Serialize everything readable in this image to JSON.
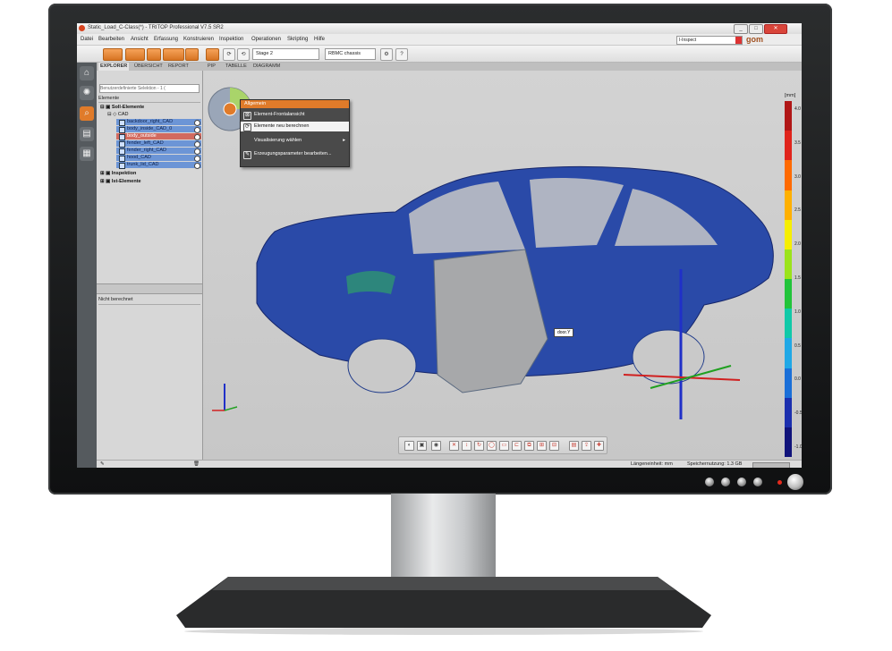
{
  "window": {
    "title": "Static_Load_C-Class(*) - TRITOP Professional V7.5 SR2",
    "controls": [
      "_",
      "□",
      "✕"
    ]
  },
  "menu": [
    "Datei",
    "Bearbeiten",
    "Ansicht",
    "Erfassung",
    "Konstruieren",
    "Inspektion",
    "Operationen",
    "Skripting",
    "Hilfe"
  ],
  "inspect_selector": "I-Inspect",
  "brand": "gom",
  "toolbar": {
    "stage": "Stage 2",
    "alignment": "RBMC chassis",
    "help": "?"
  },
  "tabs": [
    "EXPLORER",
    "ÜBERSICHT",
    "REPORT",
    "PIP",
    "TABELLE",
    "DIAGRAMM"
  ],
  "explorer": {
    "search_placeholder": "Benutzerdefinierte Selektion - 1 (",
    "header": "Elemente",
    "root": "Soll-Elemente",
    "cad": "CAD",
    "cad_items": [
      "backdoor_right_CAD",
      "body_inside_CAD_0",
      "body_outside",
      "fender_left_CAD",
      "fender_right_CAD",
      "hood_CAD",
      "trunk_lid_CAD"
    ],
    "selected_index": 2,
    "others": [
      "Inspektion",
      "Ist-Elemente"
    ],
    "lower_status": "Nicht berechnet"
  },
  "context_menu": {
    "header": "Allgemein",
    "items": [
      {
        "label": "Element-Frontalansicht",
        "icon": "frontal-view-icon"
      },
      {
        "label": "Elemente neu berechnen",
        "icon": "recompute-icon"
      },
      {
        "label": "Visualisierung wählen",
        "icon": ""
      },
      {
        "label": "Erzeugungsparameter bearbeiten...",
        "icon": "edit-params-icon"
      }
    ],
    "highlight_index": 1,
    "submenu_arrow": "▸"
  },
  "viewport": {
    "element_label": "door.Y"
  },
  "color_scale": {
    "unit": "[mm]",
    "labels": [
      "4.0",
      "3.5",
      "3.0",
      "2.5",
      "2.0",
      "1.5",
      "1.0",
      "0.5",
      "0.0",
      "-0.5",
      "-1.0"
    ],
    "colors": [
      "#b01616",
      "#e0241c",
      "#ff6a00",
      "#ffb000",
      "#f6ee00",
      "#9be31b",
      "#22c43a",
      "#10c9a8",
      "#20a8e6",
      "#1a6fd8",
      "#1b2fae",
      "#10137a"
    ]
  },
  "status_bar": {
    "units": "Längeneinheit: mm",
    "memory": "Speichernutzung: 1.3 GB"
  }
}
